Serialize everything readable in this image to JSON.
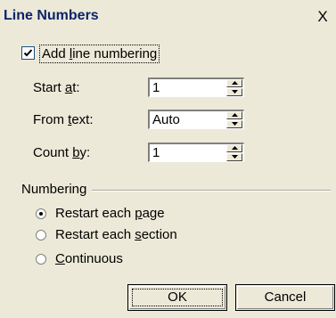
{
  "dialog": {
    "title": "Line Numbers",
    "close_glyph": "X"
  },
  "add_line_numbering": {
    "checked": true,
    "label_pre": "Add ",
    "label_accel": "l",
    "label_post": "ine numbering"
  },
  "fields": [
    {
      "label_pre": "Start ",
      "label_accel": "a",
      "label_post": "t:",
      "value": "1"
    },
    {
      "label_pre": "From ",
      "label_accel": "t",
      "label_post": "ext:",
      "value": "Auto"
    },
    {
      "label_pre": "Count ",
      "label_accel": "b",
      "label_post": "y:",
      "value": "1"
    }
  ],
  "numbering": {
    "group_label": "Numbering",
    "options": [
      {
        "label_pre": "Restart each ",
        "label_accel": "p",
        "label_post": "age",
        "selected": true
      },
      {
        "label_pre": "Restart each ",
        "label_accel": "s",
        "label_post": "ection",
        "selected": false
      },
      {
        "label_pre": "",
        "label_accel": "C",
        "label_post": "ontinuous",
        "selected": false
      }
    ]
  },
  "buttons": {
    "ok": "OK",
    "cancel": "Cancel"
  },
  "colors": {
    "dialog_bg": "#ece9d8",
    "title_text": "#0a246a"
  }
}
